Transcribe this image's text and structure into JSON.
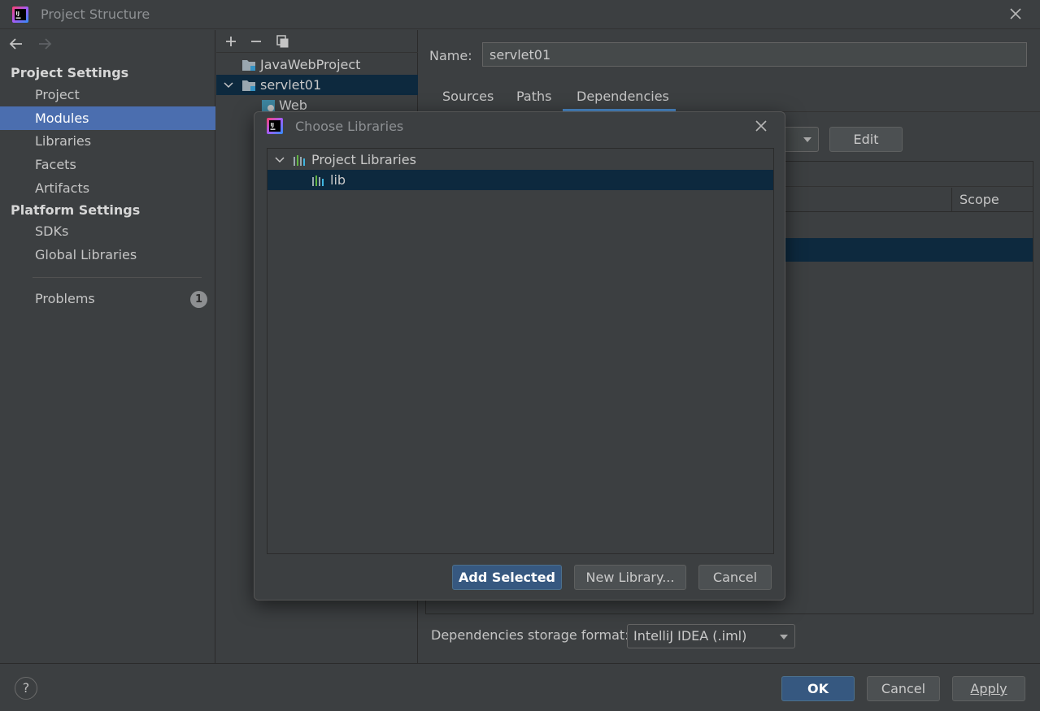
{
  "window": {
    "title": "Project Structure",
    "app_icon": "intellij-idea-icon",
    "close_icon": "close-icon"
  },
  "sidebar": {
    "back_icon": "arrow-left-icon",
    "forward_icon": "arrow-right-icon",
    "project_settings_header": "Project Settings",
    "project_settings_items": [
      {
        "label": "Project",
        "selected": false
      },
      {
        "label": "Modules",
        "selected": true
      },
      {
        "label": "Libraries",
        "selected": false
      },
      {
        "label": "Facets",
        "selected": false
      },
      {
        "label": "Artifacts",
        "selected": false
      }
    ],
    "platform_settings_header": "Platform Settings",
    "platform_settings_items": [
      {
        "label": "SDKs"
      },
      {
        "label": "Global Libraries"
      }
    ],
    "problems_label": "Problems",
    "problems_count": "1"
  },
  "modules": {
    "toolbar": {
      "add_icon": "plus-icon",
      "remove_icon": "minus-icon",
      "copy_icon": "copy-icon"
    },
    "tree": [
      {
        "label": "JavaWebProject",
        "icon": "module-folder-icon"
      },
      {
        "label": "servlet01",
        "icon": "module-folder-icon",
        "expanded": true,
        "selected": true
      },
      {
        "label": "Web",
        "icon": "web-facet-icon"
      }
    ]
  },
  "details": {
    "name_label": "Name:",
    "name_value": "servlet01",
    "tabs": [
      {
        "label": "Sources",
        "active": false
      },
      {
        "label": "Paths",
        "active": false
      },
      {
        "label": "Dependencies",
        "active": true
      }
    ],
    "edit_button": "Edit",
    "scope_header": "Scope",
    "storage_label": "Dependencies storage format:",
    "storage_value": "IntelliJ IDEA (.iml)"
  },
  "footer": {
    "help_label": "?",
    "ok": "OK",
    "cancel": "Cancel",
    "apply": "Apply"
  },
  "dialog": {
    "title": "Choose Libraries",
    "icon": "intellij-idea-icon",
    "close_icon": "close-icon",
    "tree": [
      {
        "label": "Project Libraries",
        "icon": "library-icon",
        "expanded": true,
        "selected": false
      },
      {
        "label": "lib",
        "icon": "library-icon",
        "selected": true
      }
    ],
    "add_selected": "Add Selected",
    "new_library": "New Library...",
    "cancel": "Cancel"
  },
  "colors": {
    "background": "#3c3f41",
    "selection_sidebar": "#4b6eaf",
    "selection_tree": "#0d293e",
    "primary_button": "#365880",
    "tab_underline": "#4a88c7"
  }
}
